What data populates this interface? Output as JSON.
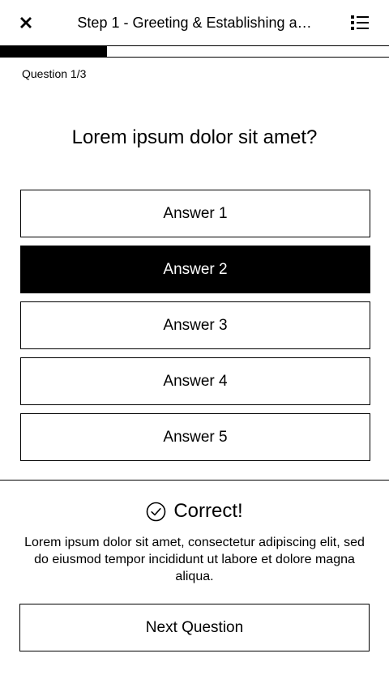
{
  "header": {
    "title": "Step 1 - Greeting & Establishing a…",
    "close_icon": "close-icon",
    "menu_icon": "list-icon"
  },
  "progress": {
    "fraction": 0.275
  },
  "question": {
    "counter": "Question 1/3",
    "text": "Lorem ipsum dolor sit amet?"
  },
  "answers": [
    {
      "label": "Answer 1",
      "selected": false
    },
    {
      "label": "Answer 2",
      "selected": true
    },
    {
      "label": "Answer 3",
      "selected": false
    },
    {
      "label": "Answer 4",
      "selected": false
    },
    {
      "label": "Answer 5",
      "selected": false
    }
  ],
  "feedback": {
    "icon": "check-circle-icon",
    "title": "Correct!",
    "text": "Lorem ipsum dolor sit amet, consectetur adipiscing elit, sed do eiusmod tempor incididunt ut labore et dolore magna aliqua."
  },
  "next_button": {
    "label": "Next Question"
  },
  "colors": {
    "primary": "#000000",
    "background": "#ffffff"
  }
}
